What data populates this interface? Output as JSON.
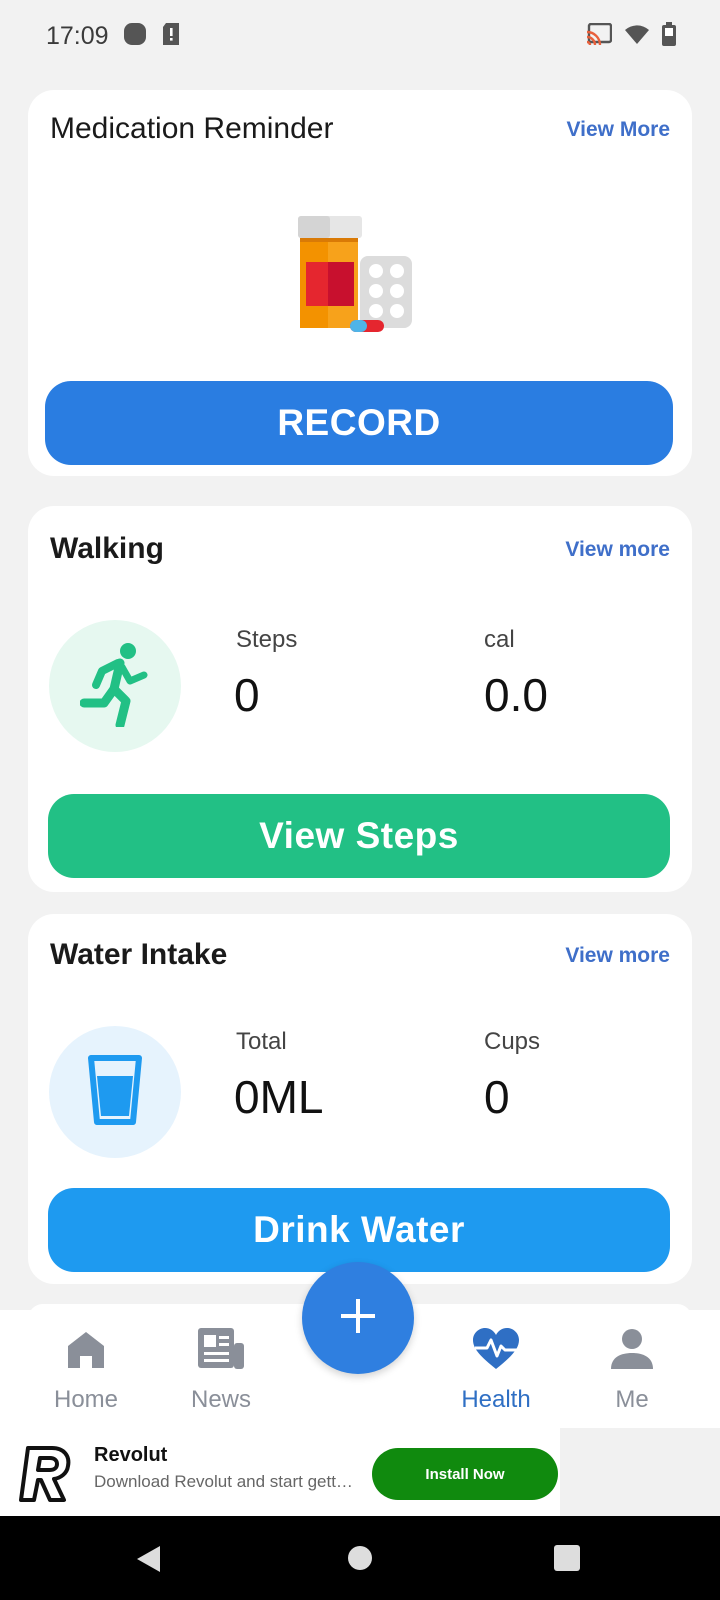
{
  "status_bar": {
    "time": "17:09"
  },
  "medication": {
    "title": "Medication Reminder",
    "link": "View More",
    "button": "RECORD"
  },
  "walking": {
    "title": "Walking",
    "link": "View more",
    "steps_label": "Steps",
    "steps_value": "0",
    "cal_label": "cal",
    "cal_value": "0.0",
    "button": "View Steps"
  },
  "water": {
    "title": "Water Intake",
    "link": "View more",
    "total_label": "Total",
    "total_value": "0ML",
    "cups_label": "Cups",
    "cups_value": "0",
    "button": "Drink Water"
  },
  "bottom_nav": {
    "items": [
      {
        "label": "Home",
        "icon": "home-icon"
      },
      {
        "label": "News",
        "icon": "news-icon"
      },
      {
        "label": "Health",
        "icon": "heart-pulse-icon",
        "active": true
      },
      {
        "label": "Me",
        "icon": "person-icon"
      }
    ]
  },
  "ad": {
    "title": "Revolut",
    "subtitle": "Download Revolut and start getting more from your money",
    "button": "Install Now"
  },
  "colors": {
    "record_button": "#2a7de1",
    "walk_button": "#22c085",
    "water_button": "#1e9af0",
    "link": "#3f6fc9",
    "nav_active": "#2f6fc4",
    "nav_inactive": "#8a8f99",
    "install_button": "#108a0e"
  }
}
